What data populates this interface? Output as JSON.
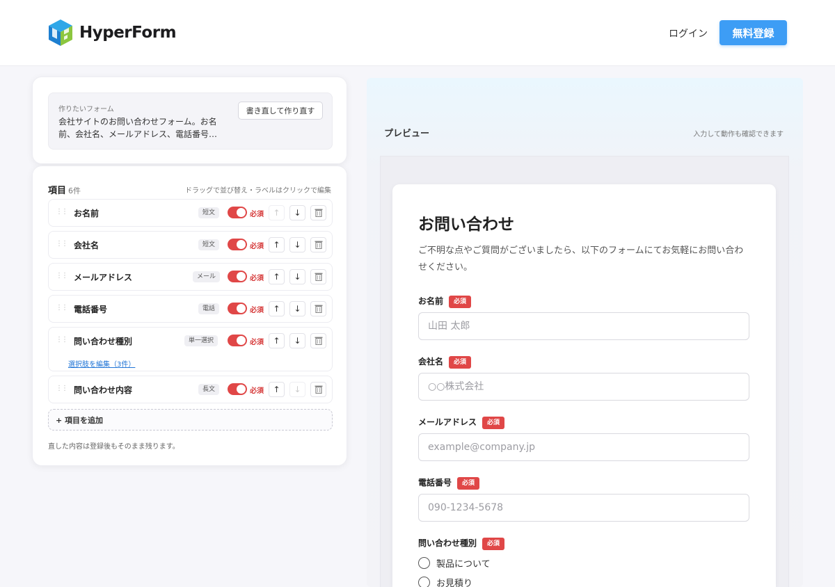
{
  "brand": {
    "name": "HyperForm"
  },
  "header": {
    "login": "ログイン",
    "signup": "無料登録"
  },
  "prompt": {
    "label": "作りたいフォーム",
    "text": "会社サイトのお問い合わせフォーム。お名前、会社名、メールアドレス、電話番号…",
    "rewrite_button": "書き直して作り直す"
  },
  "fields": {
    "title": "項目",
    "count": "6件",
    "hint": "ドラッグで並び替え・ラベルはクリックで編集",
    "required_label": "必須",
    "items": [
      {
        "name": "お名前",
        "type": "短文",
        "required": true
      },
      {
        "name": "会社名",
        "type": "短文",
        "required": true
      },
      {
        "name": "メールアドレス",
        "type": "メール",
        "required": true
      },
      {
        "name": "電話番号",
        "type": "電話",
        "required": true
      },
      {
        "name": "問い合わせ種別",
        "type": "単一選択",
        "required": true,
        "edit_choices": "選択肢を編集（3件）"
      },
      {
        "name": "問い合わせ内容",
        "type": "長文",
        "required": true
      }
    ],
    "add_button": "+ 項目を追加",
    "footnote": "直した内容は登録後もそのまま残ります。"
  },
  "preview": {
    "title": "プレビュー",
    "hint": "入力して動作も確認できます",
    "form": {
      "heading": "お問い合わせ",
      "description": "ご不明な点やご質問がございましたら、以下のフォームにてお気軽にお問い合わせください。",
      "required_badge": "必須",
      "fields": [
        {
          "label": "お名前",
          "placeholder": "山田 太郎"
        },
        {
          "label": "会社名",
          "placeholder": "○○株式会社"
        },
        {
          "label": "メールアドレス",
          "placeholder": "example@company.jp"
        },
        {
          "label": "電話番号",
          "placeholder": "090-1234-5678"
        }
      ],
      "radio_group": {
        "label": "問い合わせ種別",
        "options": [
          "製品について",
          "お見積り"
        ]
      }
    }
  },
  "colors": {
    "accent": "#3d9df5",
    "required": "#e04747",
    "link": "#1f74d6"
  }
}
